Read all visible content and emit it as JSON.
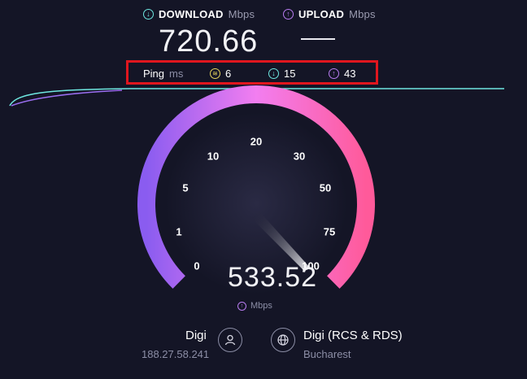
{
  "download": {
    "label": "DOWNLOAD",
    "unit": "Mbps",
    "value": "720.66",
    "icon": "download-arrow-icon",
    "color": "#6ee7e0"
  },
  "upload": {
    "label": "UPLOAD",
    "unit": "Mbps",
    "value": "",
    "icon": "upload-arrow-icon",
    "color": "#b87cf0"
  },
  "ping": {
    "label": "Ping",
    "unit": "ms",
    "idle": {
      "icon": "ping-jitter-icon",
      "value": "6"
    },
    "download": {
      "icon": "download-arrow-icon",
      "value": "15"
    },
    "upload": {
      "icon": "upload-arrow-icon",
      "value": "43"
    }
  },
  "gauge": {
    "ticks": [
      "0",
      "1",
      "5",
      "10",
      "20",
      "30",
      "50",
      "75",
      "100"
    ],
    "current_speed": "533.52",
    "unit": "Mbps",
    "gradient_start": "#8a5cf0",
    "gradient_mid": "#f27ef0",
    "gradient_end": "#ff5a9a"
  },
  "isp": {
    "name": "Digi",
    "ip": "188.27.58.241",
    "icon": "user-icon"
  },
  "server": {
    "name": "Digi (RCS & RDS)",
    "location": "Bucharest",
    "icon": "globe-icon"
  },
  "highlight_color": "#e0161e"
}
